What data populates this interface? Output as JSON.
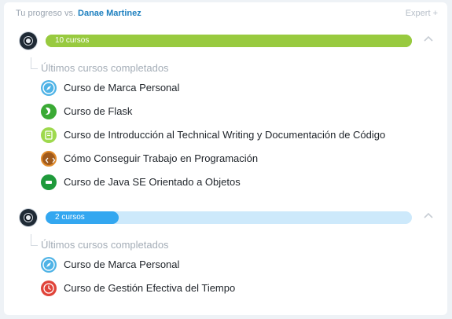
{
  "header": {
    "prefix": "Tu progreso vs.",
    "user_name": "Danae Martinez",
    "level_label": "Expert +"
  },
  "tracks": [
    {
      "count_label": "10 cursos",
      "progress_percent": 100,
      "fill_color": "#98ca3f",
      "track_color": "#98ca3f",
      "section_label": "Últimos cursos completados",
      "courses": [
        {
          "name": "Curso de Marca Personal",
          "icon": "compass-icon"
        },
        {
          "name": "Curso de Flask",
          "icon": "flask-icon"
        },
        {
          "name": "Curso de Introducción al Technical Writing y Documentación de Código",
          "icon": "document-icon"
        },
        {
          "name": "Cómo Conseguir Trabajo en Programación",
          "icon": "code-icon"
        },
        {
          "name": "Curso de Java SE Orientado a Objetos",
          "icon": "java-icon"
        }
      ]
    },
    {
      "count_label": "2 cursos",
      "progress_percent": 20,
      "fill_color": "#33a7f0",
      "track_color": "#cde9fb",
      "section_label": "Últimos cursos completados",
      "courses": [
        {
          "name": "Curso de Marca Personal",
          "icon": "compass-icon"
        },
        {
          "name": "Curso de Gestión Efectiva del Tiempo",
          "icon": "clock-icon"
        }
      ]
    }
  ]
}
